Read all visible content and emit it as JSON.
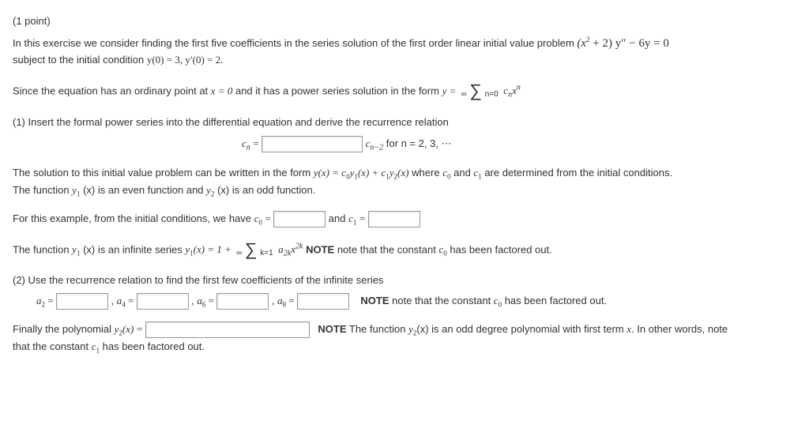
{
  "points": "(1 point)",
  "intro1": "In this exercise we consider finding the first five coefficients in the series solution of the first order linear initial value problem ",
  "ode_lhs": "(x",
  "ode_exp": "2",
  "ode_plus2": " + 2) y″ − 6y = 0",
  "intro2": "subject to the initial condition ",
  "ic": "y(0) = 3, y′(0) = 2.",
  "sinceA": "Since the equation has an ordinary point at ",
  "xeq0": "x = 0",
  "sinceB": " and it has a power series solution in the form ",
  "yeq": "y = ",
  "inf": "∞",
  "n0": "n=0",
  "cnxn_c": "c",
  "cnxn_x": "x",
  "q1": "(1) Insert the formal power series into the differential equation and derive the recurrence relation",
  "cn_label": "c",
  "cn_sub": "n",
  "eq": " = ",
  "cn2_c": "c",
  "cn2_sub": "n−2",
  "for_n": " for n = 2, 3, ⋯",
  "solnA": "The solution to this initial value problem can be written in the form ",
  "yx_form": "y(x) = c",
  "y1y2": "y",
  "sub0": "0",
  "sub1": "1",
  "sub2": "2",
  "solnB": "(x) + c",
  "solnC": "(x)",
  "solnD": " where ",
  "solnE": " and ",
  "solnF": " are determined from the initial conditions.",
  "fn_even": "The function ",
  "is_even": "(x) is an even function and ",
  "is_odd": "(x) is an odd function.",
  "forEx": "For this example, from the initial conditions, we have ",
  "and_c1": " and ",
  "y1series_a": "The function ",
  "y1series_b": "(x) is an infinite series ",
  "y1eq": "(x) = 1 + ",
  "k1": "k=1",
  "a2k": "a",
  "a2k_sub": "2k",
  "x2k_exp": "2k",
  "note1": " NOTE",
  "note1b": " note that the constant ",
  "note1c": " has been factored out.",
  "q2": "(2) Use the recurrence relation to find the first few coefficients of the infinite series",
  "a_label": "a",
  "a2_sub": "2",
  "a4_sub": "4",
  "a6_sub": "6",
  "a8_sub": "8",
  "comma": " , ",
  "note2": "NOTE",
  "note2b": " note that the constant ",
  "note2c": " has been factored out.",
  "finally": "Finally the polynomial ",
  "note3": " NOTE",
  "note3b": " The function ",
  "note3c": "(x) is an odd degree polynomial with first term ",
  "note3d": ". In other words, note",
  "last": "that the constant ",
  "last2": " has been factored out.",
  "x": "x",
  "sigma": "∑"
}
